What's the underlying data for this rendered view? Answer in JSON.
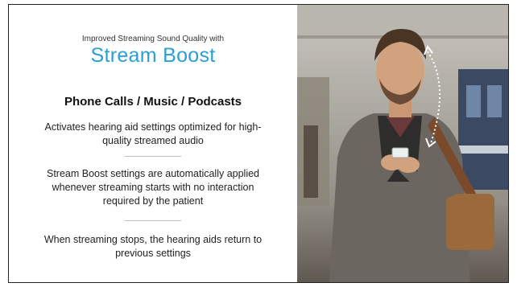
{
  "slide": {
    "subtitle": "Improved Streaming Sound Quality with",
    "title": "Stream Boost",
    "heading": "Phone Calls / Music / Podcasts",
    "bullets": [
      "Activates hearing aid settings optimized for high-quality streamed audio",
      "Stream Boost settings are automatically applied whenever streaming starts with no interaction required by the patient",
      "When streaming stops, the hearing aids return to previous settings"
    ]
  },
  "colors": {
    "title": "#2a9fd6",
    "divider": "#bdbdbd"
  },
  "photo": {
    "subject": "man-smiling-at-smartphone",
    "icon": "dotted-double-arrow-icon"
  }
}
